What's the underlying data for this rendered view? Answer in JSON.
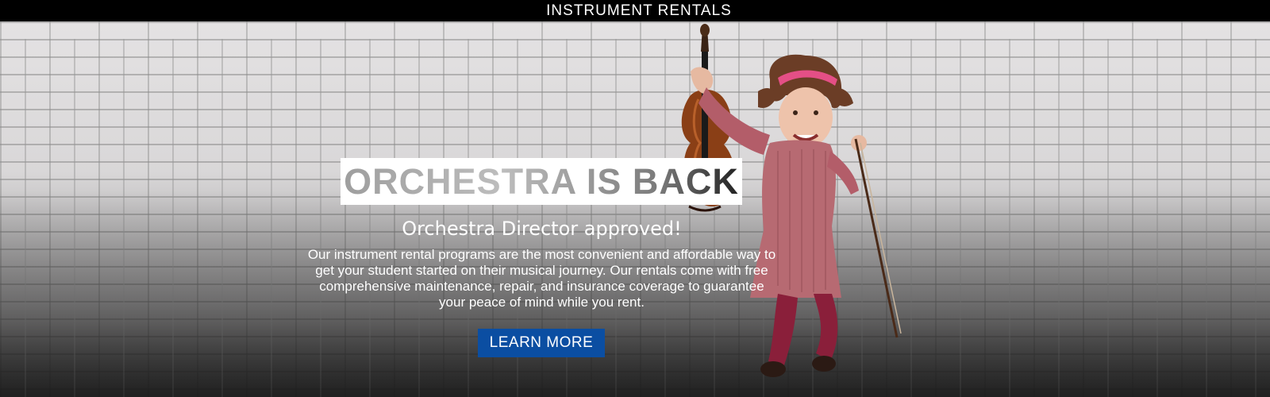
{
  "topbar": {
    "title": "INSTRUMENT RENTALS"
  },
  "hero": {
    "headline": "ORCHESTRA IS BACK",
    "subheadline": "Orchestra Director approved!",
    "body": "Our instrument rental programs are the most convenient and affordable way to get your student started on their musical journey. Our rentals come with free comprehensive maintenance, repair, and insurance coverage to guarantee your peace of mind while you rent.",
    "cta_label": "LEARN MORE"
  },
  "colors": {
    "topbar": "#000000",
    "cta": "#0b4ea2",
    "headline_box": "#ffffff"
  }
}
